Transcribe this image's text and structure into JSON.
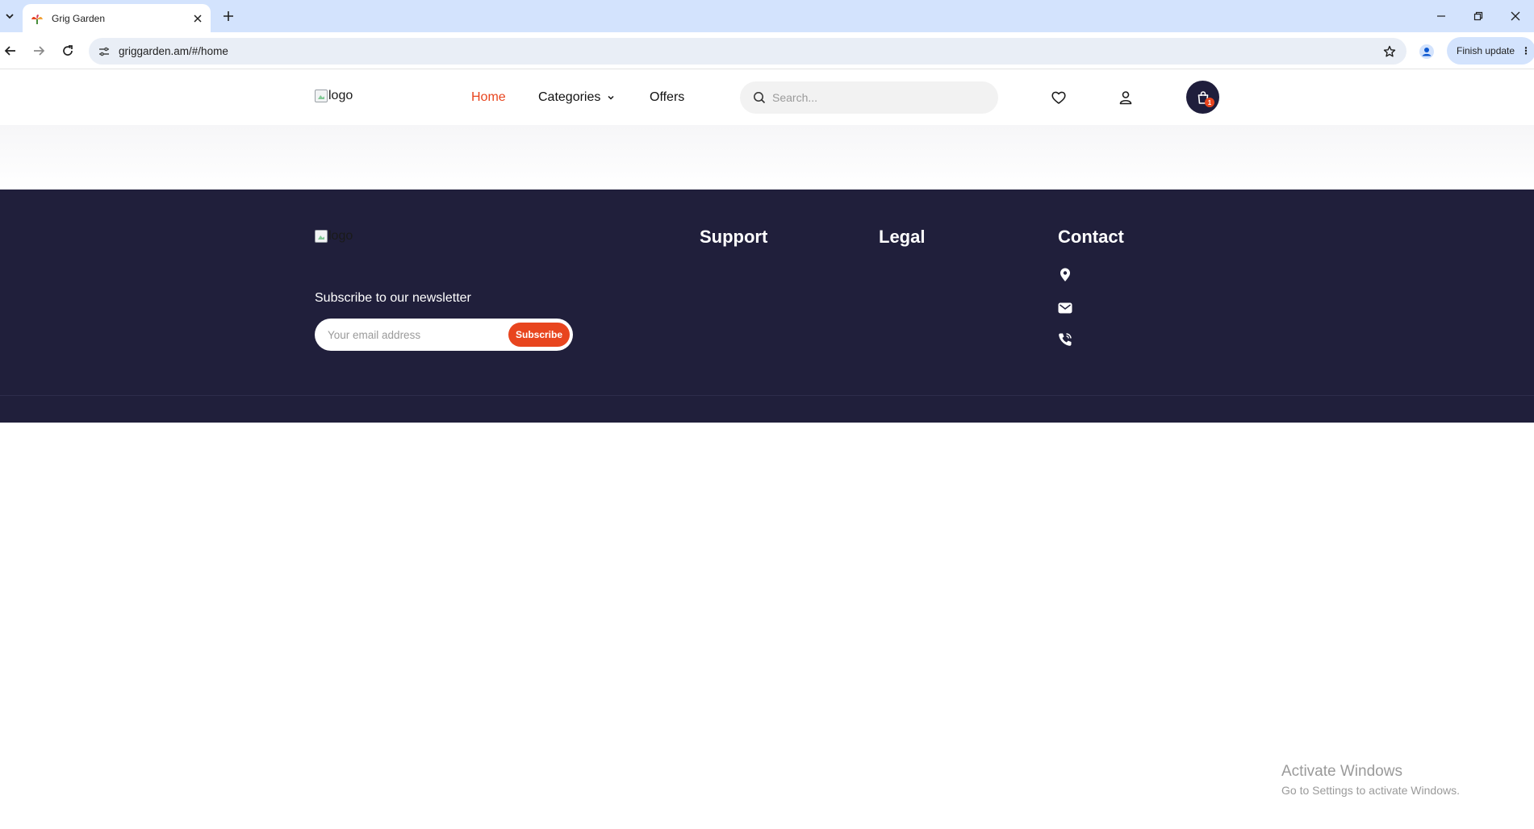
{
  "browser": {
    "tab_title": "Grig Garden",
    "url": "griggarden.am/#/home",
    "update_label": "Finish update",
    "accent": "#d3e3fd"
  },
  "header": {
    "logo_alt": "logo",
    "nav": {
      "home": "Home",
      "categories": "Categories",
      "offers": "Offers"
    },
    "search_placeholder": "Search...",
    "cart_count": "1",
    "brand_dark": "#1f1e3c",
    "accent": "#e8451e"
  },
  "footer": {
    "logo_alt": "logo",
    "headings": {
      "support": "Support",
      "legal": "Legal",
      "contact": "Contact"
    },
    "newsletter_title": "Subscribe to our newsletter",
    "email_placeholder": "Your email address",
    "subscribe_label": "Subscribe",
    "contact_icons": [
      "location-icon",
      "mail-icon",
      "phone-icon"
    ]
  },
  "watermark": {
    "line1": "Activate Windows",
    "line2": "Go to Settings to activate Windows."
  }
}
